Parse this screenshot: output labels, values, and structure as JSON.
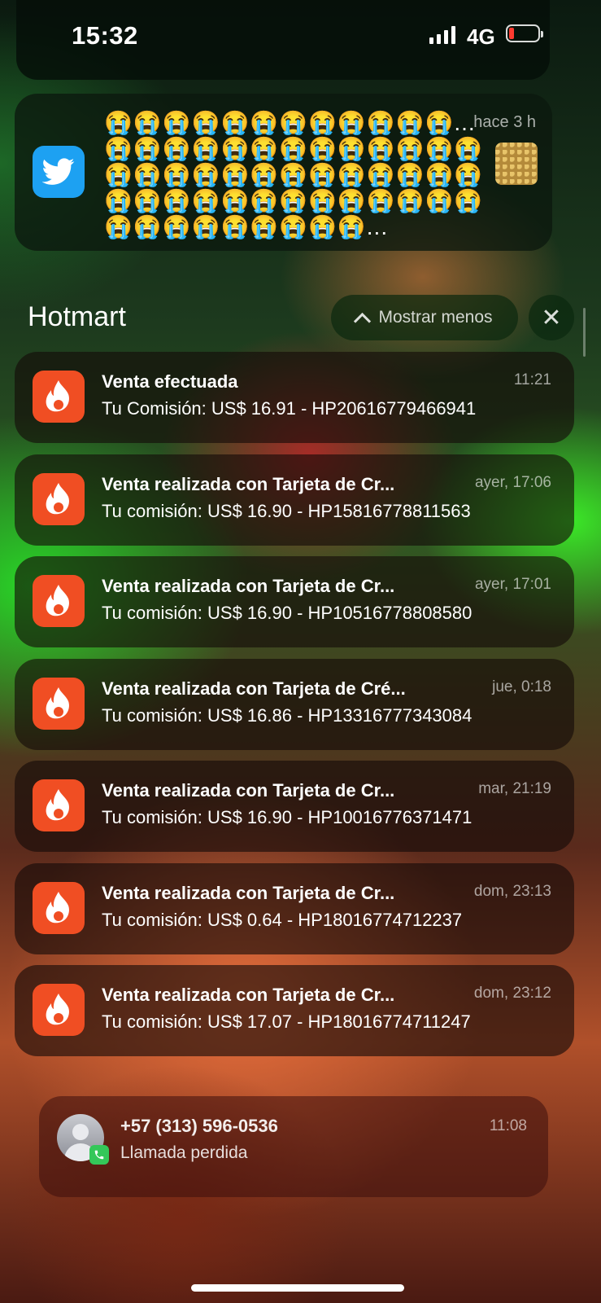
{
  "status_bar": {
    "time": "15:32",
    "network": "4G",
    "battery_color": "#ff3b30"
  },
  "twitter": {
    "icon": "twitter-bird-icon",
    "message": "😭😭😭😭😭😭😭😭😭😭😭😭...😭😭😭😭😭😭😭😭😭😭😭😭😭😭😭😭😭😭😭😭😭😭😭😭😭😭😭😭😭😭😭😭😭😭😭😭😭😭😭😭😭😭😭😭😭😭😭😭...",
    "time": "hace 3 h",
    "accent": "#1da1f2"
  },
  "group": {
    "title": "Hotmart",
    "show_less": "Mostrar menos",
    "close": "✕"
  },
  "notifications": [
    {
      "title": "Venta efectuada",
      "body": "Tu Comisión: US$ 16.91 - HP20616779466941",
      "time": "11:21"
    },
    {
      "title": "Venta realizada con Tarjeta de Cr...",
      "body": "Tu comisión: US$ 16.90 - HP15816778811563",
      "time": "ayer, 17:06"
    },
    {
      "title": "Venta realizada con Tarjeta de Cr...",
      "body": "Tu comisión: US$ 16.90 - HP10516778808580",
      "time": "ayer, 17:01"
    },
    {
      "title": "Venta realizada con Tarjeta de Cré...",
      "body": "Tu comisión: US$ 16.86 - HP13316777343084",
      "time": "jue, 0:18"
    },
    {
      "title": "Venta realizada con Tarjeta de Cr...",
      "body": "Tu comisión: US$ 16.90 - HP10016776371471",
      "time": "mar, 21:19"
    },
    {
      "title": "Venta realizada con Tarjeta de Cr...",
      "body": "Tu comisión: US$ 0.64 - HP18016774712237",
      "time": "dom, 23:13"
    },
    {
      "title": "Venta realizada con Tarjeta de Cr...",
      "body": "Tu comisión: US$ 17.07 - HP18016774711247",
      "time": "dom, 23:12"
    }
  ],
  "hotmart_color": "#f04e23",
  "call": {
    "title": "+57 (313) 596-0536",
    "body": "Llamada perdida",
    "time": "11:08"
  }
}
